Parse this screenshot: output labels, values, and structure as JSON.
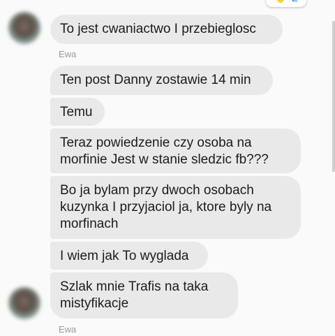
{
  "reaction": {
    "count": "2"
  },
  "messages": [
    {
      "text": "To jest cwaniactwo I przebieglosc"
    },
    {
      "text": "Ten post Danny zostawie 14 min"
    },
    {
      "text": "Temu"
    },
    {
      "text": "Teraz powiedzenie czy osoba na morfinie Jest w stanie sledzic fb???"
    },
    {
      "text": "Bo ja bylam przy dwoch osobach kuzynka I przyjaciol ja, ktore byly na morfinach"
    },
    {
      "text": "I wiem jak To wyglada"
    },
    {
      "text": "Szlak mnie Trafis na taka mistyfikacje"
    }
  ],
  "senders": [
    "Ewa",
    "Ewa"
  ]
}
